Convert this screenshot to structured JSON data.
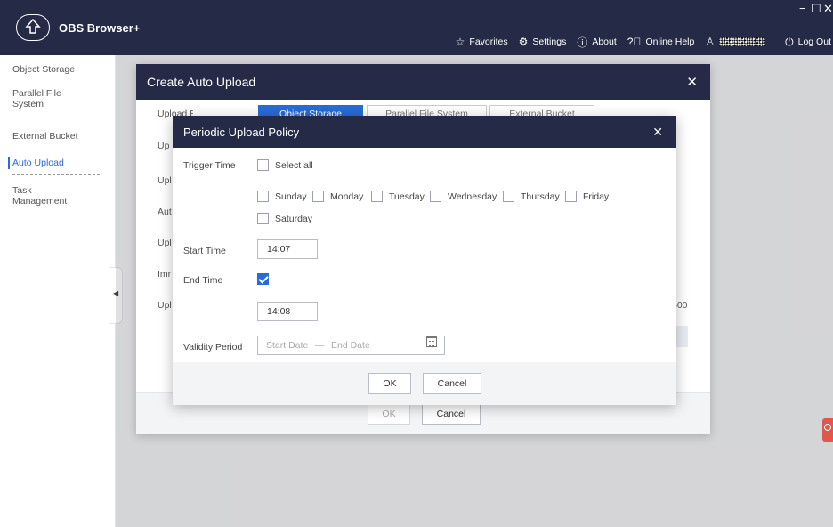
{
  "app": {
    "name": "OBS Browser+"
  },
  "window_controls": {
    "minimize": "−",
    "maximize": "☐",
    "close": "✕"
  },
  "nav": {
    "favorites": "Favorites",
    "settings": "Settings",
    "about": "About",
    "online_help": "Online Help",
    "logout": "Log Out"
  },
  "sidebar": {
    "items": [
      {
        "label": "Object Storage"
      },
      {
        "label": "Parallel File System"
      },
      {
        "label": "External Bucket"
      },
      {
        "label": "Auto Upload"
      },
      {
        "label": "Task Management"
      }
    ]
  },
  "create_dialog": {
    "title": "Create Auto Upload",
    "labels": [
      "Upload Bucket Type",
      "Up",
      "Upl",
      "Aut",
      "Upl",
      "Imr",
      "Upl"
    ],
    "bucket_types": [
      "Object Storage",
      "Parallel File System",
      "External Bucket"
    ],
    "side_value": "500",
    "ok_label": "OK",
    "cancel_label": "Cancel"
  },
  "policy_dialog": {
    "title": "Periodic Upload Policy",
    "trigger_time_label": "Trigger Time",
    "select_all_label": "Select all",
    "days": [
      "Sunday",
      "Monday",
      "Tuesday",
      "Wednesday",
      "Thursday",
      "Friday",
      "Saturday"
    ],
    "start_time_label": "Start Time",
    "start_time_value": "14:07",
    "end_time_label": "End Time",
    "end_time_checked": true,
    "end_time_value": "14:08",
    "validity_label": "Validity Period",
    "start_date_placeholder": "Start Date",
    "date_separator": "—",
    "end_date_placeholder": "End Date",
    "ok_label": "OK",
    "cancel_label": "Cancel"
  },
  "colors": {
    "header_bg": "#252b47",
    "accent": "#2a6bd6",
    "feedback_tab": "#e2574c"
  }
}
